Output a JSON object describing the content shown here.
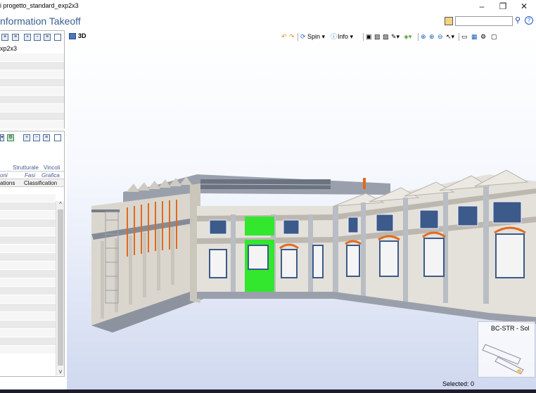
{
  "window": {
    "title": "i progetto_standard_exp2x3",
    "minimize_glyph": "–",
    "restore_glyph": "❐",
    "close_glyph": "✕"
  },
  "app": {
    "title": "nformation Takeoff",
    "search": {
      "value": "",
      "placeholder": ""
    },
    "find_icon": "binoculars-icon",
    "help_glyph": "?"
  },
  "left_panel": {
    "tree": {
      "root_label": "xp2x3"
    },
    "property_tabs": {
      "row1": [
        "Strutturale",
        "Vincoli"
      ],
      "row2": [
        "oni",
        "Fasi",
        "Grafica"
      ],
      "row3": [
        "ations",
        "Classification"
      ]
    }
  },
  "viewport": {
    "tab_label": "3D",
    "toolbar": {
      "spin_label": "Spin",
      "info_label": "Info"
    },
    "navcube_label": "BC-STR - Sol"
  },
  "status": {
    "selected_text": "Selected: 0"
  },
  "colors": {
    "selection_green": "#33e62e",
    "app_title_blue": "#3a5d8f",
    "orange_column": "#e06a1d"
  }
}
